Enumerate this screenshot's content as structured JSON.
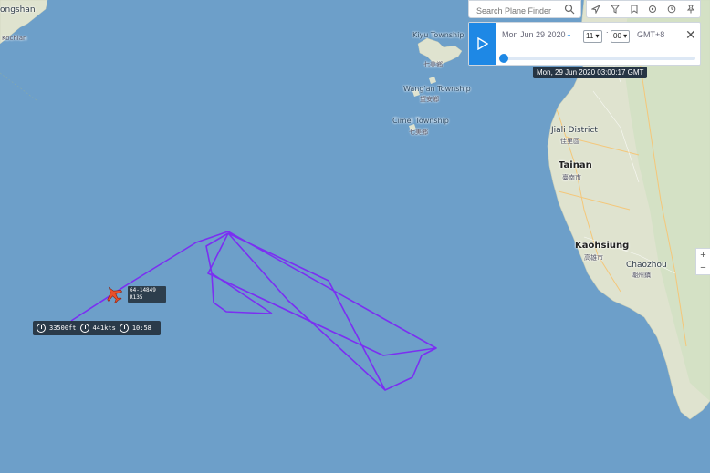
{
  "map_labels": {
    "tl_top": "ongshan",
    "tl_sub": "Kochlan",
    "kiyo": "Kiyu Township",
    "kiyo_sub": "七美鄉",
    "wangan": "Wang'an Township",
    "wangan_sub": "望安鄉",
    "cimei": "Cimei Township",
    "cimei_sub": "七美鄉",
    "jiali": "Jiali District",
    "jiali_sub": "佳里區",
    "tainan": "Tainan",
    "tainan_sub": "臺南市",
    "kaohsiung": "Kaohsiung",
    "kaohsiung_sub": "高雄市",
    "chaozhou": "Chaozhou",
    "chaozhou_sub": "潮州鎮"
  },
  "search": {
    "placeholder": "Search Plane Finder"
  },
  "toolbar": {
    "icons": [
      "location-icon",
      "filter-icon",
      "bookmark-icon",
      "settings-icon",
      "history-icon",
      "pin-icon"
    ]
  },
  "playback": {
    "date": "Mon Jun 29 2020",
    "hour": "11 ▾",
    "minute": "00 ▾",
    "separator": ":",
    "timezone": "GMT+8",
    "progress": 0.02,
    "tooltip": "Mon, 29 Jun 2020 03:00:17 GMT"
  },
  "aircraft": {
    "registration": "64-14849",
    "type": "R135",
    "altitude": "33500ft",
    "speed": "441kts",
    "time": "10:58"
  },
  "zoom": {
    "in": "+",
    "out": "−"
  },
  "colors": {
    "sea": "#6d9fc9",
    "land": "#dfe3cf",
    "track": "#7b2ff2",
    "accent": "#1e88e5"
  }
}
